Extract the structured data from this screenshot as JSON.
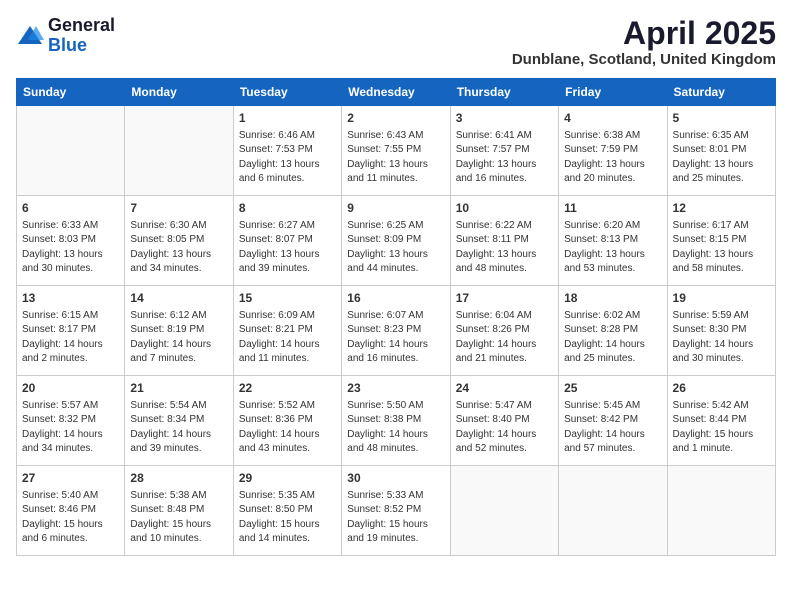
{
  "logo": {
    "general": "General",
    "blue": "Blue"
  },
  "title": "April 2025",
  "location": "Dunblane, Scotland, United Kingdom",
  "days_of_week": [
    "Sunday",
    "Monday",
    "Tuesday",
    "Wednesday",
    "Thursday",
    "Friday",
    "Saturday"
  ],
  "weeks": [
    [
      {
        "day": "",
        "sunrise": "",
        "sunset": "",
        "daylight": ""
      },
      {
        "day": "",
        "sunrise": "",
        "sunset": "",
        "daylight": ""
      },
      {
        "day": "1",
        "sunrise": "Sunrise: 6:46 AM",
        "sunset": "Sunset: 7:53 PM",
        "daylight": "Daylight: 13 hours and 6 minutes."
      },
      {
        "day": "2",
        "sunrise": "Sunrise: 6:43 AM",
        "sunset": "Sunset: 7:55 PM",
        "daylight": "Daylight: 13 hours and 11 minutes."
      },
      {
        "day": "3",
        "sunrise": "Sunrise: 6:41 AM",
        "sunset": "Sunset: 7:57 PM",
        "daylight": "Daylight: 13 hours and 16 minutes."
      },
      {
        "day": "4",
        "sunrise": "Sunrise: 6:38 AM",
        "sunset": "Sunset: 7:59 PM",
        "daylight": "Daylight: 13 hours and 20 minutes."
      },
      {
        "day": "5",
        "sunrise": "Sunrise: 6:35 AM",
        "sunset": "Sunset: 8:01 PM",
        "daylight": "Daylight: 13 hours and 25 minutes."
      }
    ],
    [
      {
        "day": "6",
        "sunrise": "Sunrise: 6:33 AM",
        "sunset": "Sunset: 8:03 PM",
        "daylight": "Daylight: 13 hours and 30 minutes."
      },
      {
        "day": "7",
        "sunrise": "Sunrise: 6:30 AM",
        "sunset": "Sunset: 8:05 PM",
        "daylight": "Daylight: 13 hours and 34 minutes."
      },
      {
        "day": "8",
        "sunrise": "Sunrise: 6:27 AM",
        "sunset": "Sunset: 8:07 PM",
        "daylight": "Daylight: 13 hours and 39 minutes."
      },
      {
        "day": "9",
        "sunrise": "Sunrise: 6:25 AM",
        "sunset": "Sunset: 8:09 PM",
        "daylight": "Daylight: 13 hours and 44 minutes."
      },
      {
        "day": "10",
        "sunrise": "Sunrise: 6:22 AM",
        "sunset": "Sunset: 8:11 PM",
        "daylight": "Daylight: 13 hours and 48 minutes."
      },
      {
        "day": "11",
        "sunrise": "Sunrise: 6:20 AM",
        "sunset": "Sunset: 8:13 PM",
        "daylight": "Daylight: 13 hours and 53 minutes."
      },
      {
        "day": "12",
        "sunrise": "Sunrise: 6:17 AM",
        "sunset": "Sunset: 8:15 PM",
        "daylight": "Daylight: 13 hours and 58 minutes."
      }
    ],
    [
      {
        "day": "13",
        "sunrise": "Sunrise: 6:15 AM",
        "sunset": "Sunset: 8:17 PM",
        "daylight": "Daylight: 14 hours and 2 minutes."
      },
      {
        "day": "14",
        "sunrise": "Sunrise: 6:12 AM",
        "sunset": "Sunset: 8:19 PM",
        "daylight": "Daylight: 14 hours and 7 minutes."
      },
      {
        "day": "15",
        "sunrise": "Sunrise: 6:09 AM",
        "sunset": "Sunset: 8:21 PM",
        "daylight": "Daylight: 14 hours and 11 minutes."
      },
      {
        "day": "16",
        "sunrise": "Sunrise: 6:07 AM",
        "sunset": "Sunset: 8:23 PM",
        "daylight": "Daylight: 14 hours and 16 minutes."
      },
      {
        "day": "17",
        "sunrise": "Sunrise: 6:04 AM",
        "sunset": "Sunset: 8:26 PM",
        "daylight": "Daylight: 14 hours and 21 minutes."
      },
      {
        "day": "18",
        "sunrise": "Sunrise: 6:02 AM",
        "sunset": "Sunset: 8:28 PM",
        "daylight": "Daylight: 14 hours and 25 minutes."
      },
      {
        "day": "19",
        "sunrise": "Sunrise: 5:59 AM",
        "sunset": "Sunset: 8:30 PM",
        "daylight": "Daylight: 14 hours and 30 minutes."
      }
    ],
    [
      {
        "day": "20",
        "sunrise": "Sunrise: 5:57 AM",
        "sunset": "Sunset: 8:32 PM",
        "daylight": "Daylight: 14 hours and 34 minutes."
      },
      {
        "day": "21",
        "sunrise": "Sunrise: 5:54 AM",
        "sunset": "Sunset: 8:34 PM",
        "daylight": "Daylight: 14 hours and 39 minutes."
      },
      {
        "day": "22",
        "sunrise": "Sunrise: 5:52 AM",
        "sunset": "Sunset: 8:36 PM",
        "daylight": "Daylight: 14 hours and 43 minutes."
      },
      {
        "day": "23",
        "sunrise": "Sunrise: 5:50 AM",
        "sunset": "Sunset: 8:38 PM",
        "daylight": "Daylight: 14 hours and 48 minutes."
      },
      {
        "day": "24",
        "sunrise": "Sunrise: 5:47 AM",
        "sunset": "Sunset: 8:40 PM",
        "daylight": "Daylight: 14 hours and 52 minutes."
      },
      {
        "day": "25",
        "sunrise": "Sunrise: 5:45 AM",
        "sunset": "Sunset: 8:42 PM",
        "daylight": "Daylight: 14 hours and 57 minutes."
      },
      {
        "day": "26",
        "sunrise": "Sunrise: 5:42 AM",
        "sunset": "Sunset: 8:44 PM",
        "daylight": "Daylight: 15 hours and 1 minute."
      }
    ],
    [
      {
        "day": "27",
        "sunrise": "Sunrise: 5:40 AM",
        "sunset": "Sunset: 8:46 PM",
        "daylight": "Daylight: 15 hours and 6 minutes."
      },
      {
        "day": "28",
        "sunrise": "Sunrise: 5:38 AM",
        "sunset": "Sunset: 8:48 PM",
        "daylight": "Daylight: 15 hours and 10 minutes."
      },
      {
        "day": "29",
        "sunrise": "Sunrise: 5:35 AM",
        "sunset": "Sunset: 8:50 PM",
        "daylight": "Daylight: 15 hours and 14 minutes."
      },
      {
        "day": "30",
        "sunrise": "Sunrise: 5:33 AM",
        "sunset": "Sunset: 8:52 PM",
        "daylight": "Daylight: 15 hours and 19 minutes."
      },
      {
        "day": "",
        "sunrise": "",
        "sunset": "",
        "daylight": ""
      },
      {
        "day": "",
        "sunrise": "",
        "sunset": "",
        "daylight": ""
      },
      {
        "day": "",
        "sunrise": "",
        "sunset": "",
        "daylight": ""
      }
    ]
  ]
}
